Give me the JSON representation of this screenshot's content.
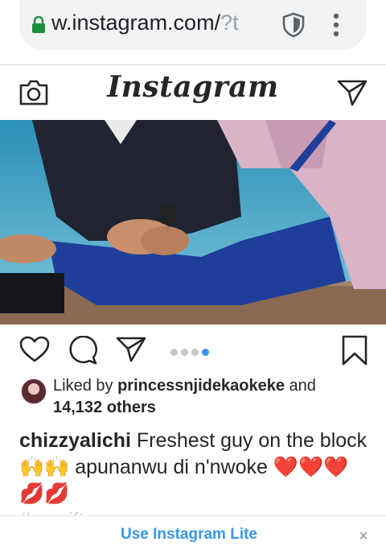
{
  "browser": {
    "url_visible": "w.instagram.com/",
    "url_faded": "?t",
    "icons": [
      "lock-icon",
      "shield-icon",
      "kebab-menu-icon"
    ]
  },
  "header": {
    "logo_text": "Instagram",
    "icons": [
      "camera-icon",
      "direct-message-icon"
    ]
  },
  "post": {
    "carousel": {
      "count": 4,
      "active_index": 3
    },
    "likes": {
      "prefix": "Liked by",
      "user": "princessnjidekaokeke",
      "joiner": "and",
      "others": "14,132 others"
    },
    "caption": {
      "username": "chizzyalichi",
      "text": "Freshest guy on the block 🙌🙌 apunanwu di n'nwoke ❤️❤️❤️💋💋",
      "hashtag": "#mygift"
    }
  },
  "banner": {
    "link_label": "Use Instagram Lite",
    "close_glyph": "×"
  },
  "colors": {
    "accent": "#3897f0",
    "text": "#262626",
    "border": "#dbdbdb"
  }
}
